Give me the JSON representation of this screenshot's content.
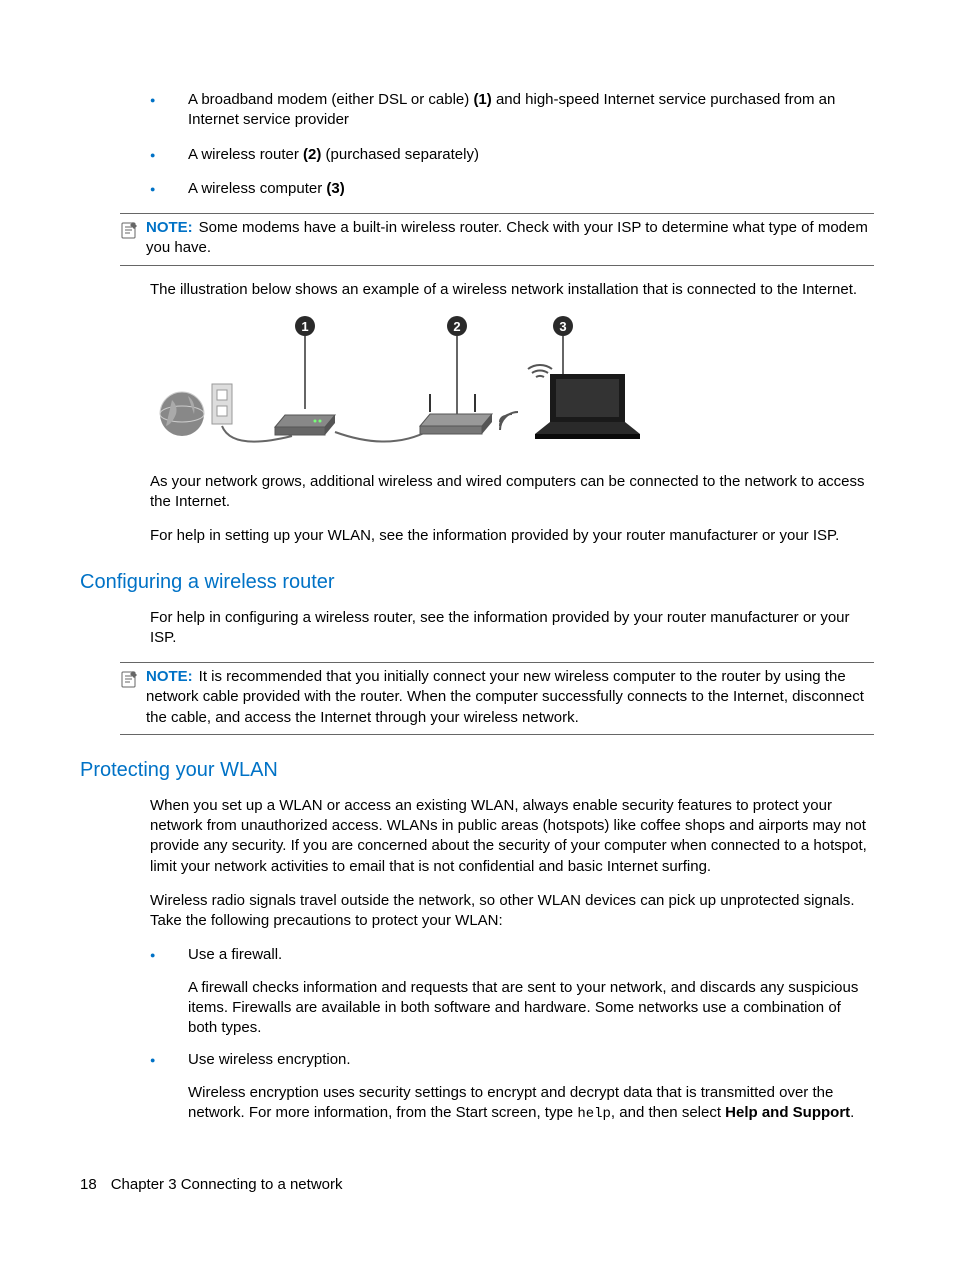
{
  "topList": {
    "item1_a": "A broadband modem (either DSL or cable) ",
    "item1_ref": "(1)",
    "item1_b": " and high-speed Internet service purchased from an Internet service provider",
    "item2_a": "A wireless router ",
    "item2_ref": "(2)",
    "item2_b": " (purchased separately)",
    "item3_a": "A wireless computer ",
    "item3_ref": "(3)"
  },
  "note1": {
    "label": "NOTE:",
    "text": "Some modems have a built-in wireless router. Check with your ISP to determine what type of modem you have."
  },
  "para_illust_intro": "The illustration below shows an example of a wireless network installation that is connected to the Internet.",
  "para_grows": "As your network grows, additional wireless and wired computers can be connected to the network to access the Internet.",
  "para_help_wlan": "For help in setting up your WLAN, see the information provided by your router manufacturer or your ISP.",
  "heading_config": "Configuring a wireless router",
  "para_config": "For help in configuring a wireless router, see the information provided by your router manufacturer or your ISP.",
  "note2": {
    "label": "NOTE:",
    "text": "It is recommended that you initially connect your new wireless computer to the router by using the network cable provided with the router. When the computer successfully connects to the Internet, disconnect the cable, and access the Internet through your wireless network."
  },
  "heading_protect": "Protecting your WLAN",
  "para_protect1": "When you set up a WLAN or access an existing WLAN, always enable security features to protect your network from unauthorized access. WLANs in public areas (hotspots) like coffee shops and airports may not provide any security. If you are concerned about the security of your computer when connected to a hotspot, limit your network activities to email that is not confidential and basic Internet surfing.",
  "para_protect2": "Wireless radio signals travel outside the network, so other WLAN devices can pick up unprotected signals. Take the following precautions to protect your WLAN:",
  "precautions": {
    "p1_head": "Use a firewall.",
    "p1_body": "A firewall checks information and requests that are sent to your network, and discards any suspicious items. Firewalls are available in both software and hardware. Some networks use a combination of both types.",
    "p2_head": "Use wireless encryption.",
    "p2_body_a": "Wireless encryption uses security settings to encrypt and decrypt data that is transmitted over the network. For more information, from the Start screen, type ",
    "p2_code": "help",
    "p2_body_b": ", and then select ",
    "p2_bold": "Help and Support",
    "p2_body_c": "."
  },
  "footer": {
    "page": "18",
    "chapter": "Chapter 3   Connecting to a network"
  }
}
